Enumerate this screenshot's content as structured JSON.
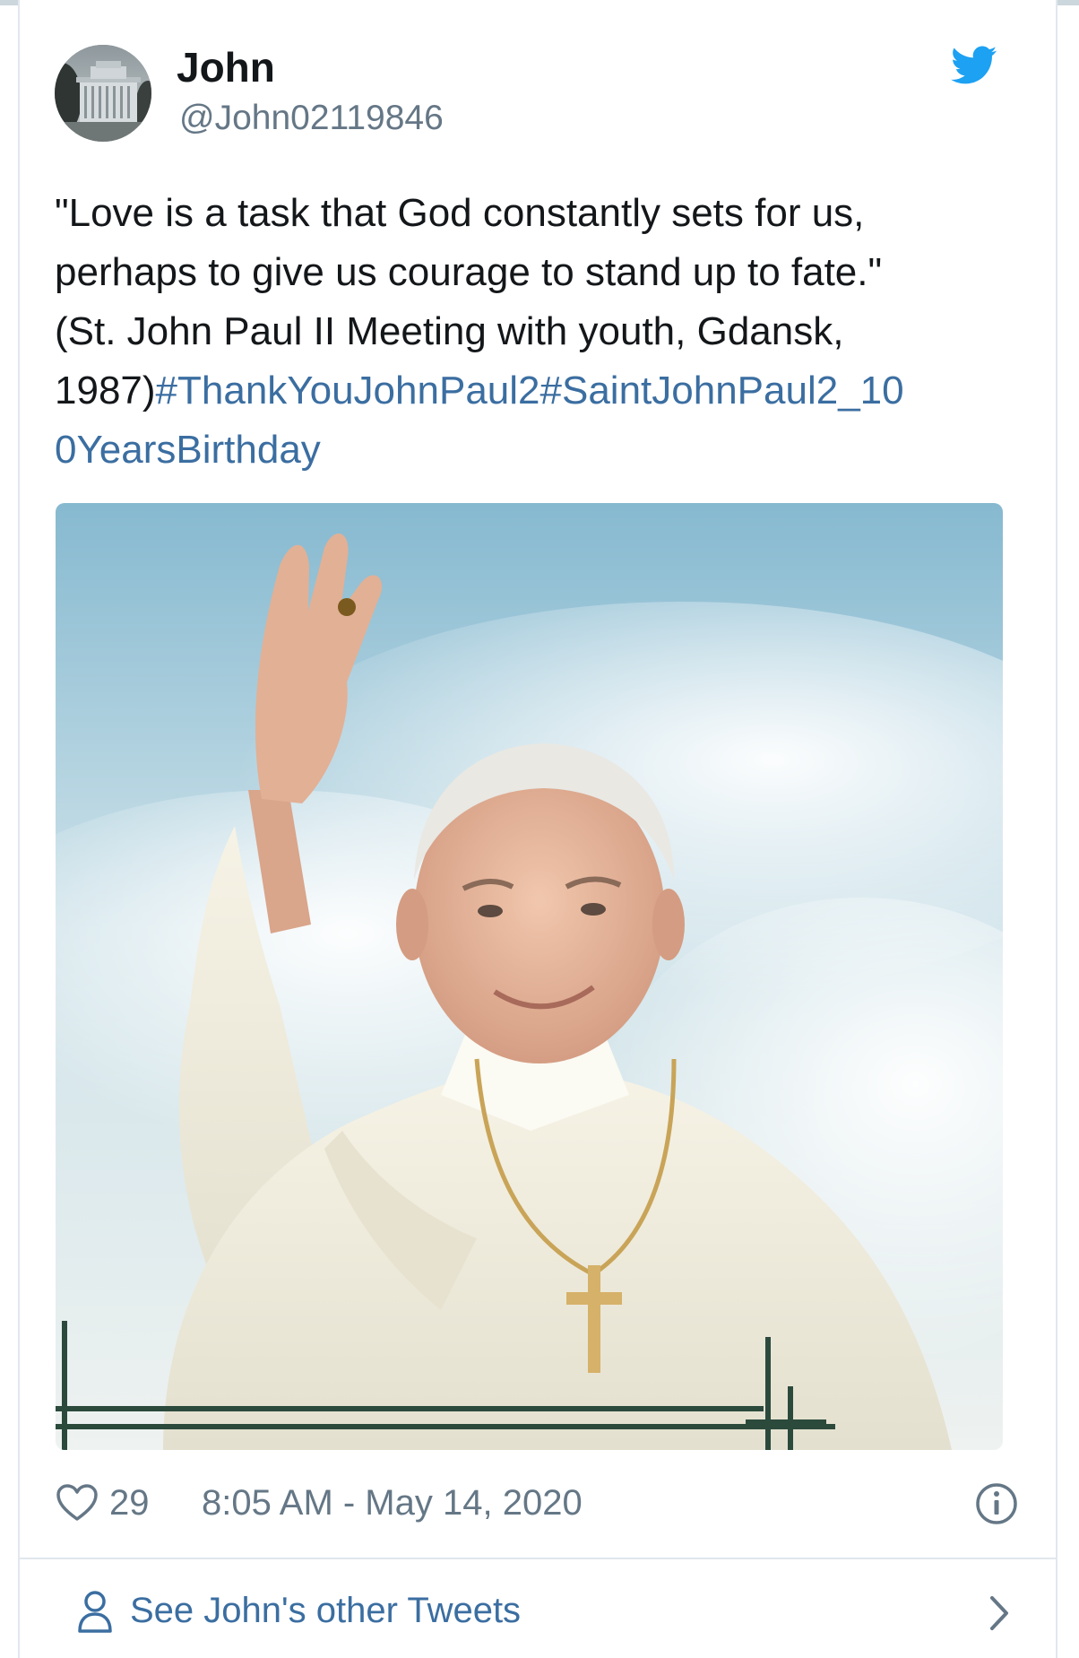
{
  "author": {
    "name": "John",
    "handle": "@John02119846"
  },
  "tweet": {
    "text_lines": [
      "\"Love is a task that God constantly sets for us,",
      "perhaps to give us courage to stand up to fate.\"",
      "(St. John Paul II Meeting with youth, Gdansk,"
    ],
    "text_tail": "1987)",
    "hashtag_part1": "#ThankYouJohnPaul2#SaintJohnPaul2_10",
    "hashtag_part2": "0YearsBirthday"
  },
  "footer": {
    "likes": "29",
    "timestamp": "8:05 AM - May 14, 2020"
  },
  "other_tweets_link": "See John's other Tweets",
  "icons": {
    "brand": "twitter-bird-icon",
    "like": "heart-icon",
    "info": "info-icon",
    "profile": "person-icon",
    "more": "chevron-right-icon"
  },
  "colors": {
    "twitter_blue": "#1da1f2",
    "link_blue": "#3b6ea1",
    "muted_text": "#657786",
    "border": "#e1e8ed"
  }
}
